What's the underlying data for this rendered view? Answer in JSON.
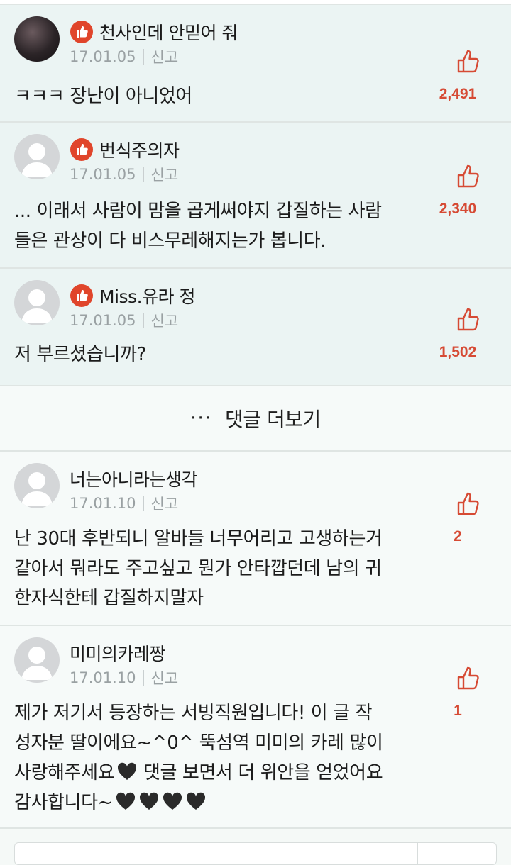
{
  "comments": [
    {
      "type": "best",
      "avatar": "photo",
      "nickname": "천사인데 안믿어 줘",
      "date": "17.01.05",
      "report": "신고",
      "lines": [
        "ㅋㅋㅋ 장난이 아니었어"
      ],
      "likes": "2,491"
    },
    {
      "type": "best",
      "avatar": "default",
      "nickname": "번식주의자",
      "date": "17.01.05",
      "report": "신고",
      "lines": [
        "... 이래서 사람이 맘을 곱게써야지 갑질하는 사람",
        "들은 관상이 다 비스무레해지는가 봅니다."
      ],
      "likes": "2,340"
    },
    {
      "type": "best",
      "avatar": "default",
      "nickname": "Miss.유라 정",
      "date": "17.01.05",
      "report": "신고",
      "lines": [
        "저 부르셨습니까?"
      ],
      "likes": "1,502"
    }
  ],
  "more_comments": {
    "dots": "···",
    "label": "댓글 더보기"
  },
  "recent_comments": [
    {
      "avatar": "default",
      "nickname": "너는아니라는생각",
      "date": "17.01.10",
      "report": "신고",
      "lines": [
        "난 30대 후반되니 알바들 너무어리고 고생하는거",
        "같아서 뭐라도 주고싶고 뭔가 안타깝던데 남의 귀",
        "한자식한테 갑질하지말자"
      ],
      "likes": "2"
    },
    {
      "avatar": "default",
      "nickname": "미미의카레짱",
      "date": "17.01.10",
      "report": "신고",
      "lines": [
        "제가 저기서 등장하는 서빙직원입니다! 이 글 작",
        "성자분 딸이에요~^0^ 뚝섬역 미미의 카레 많이",
        "사랑해주세요",
        "감사합니다~"
      ],
      "line3_tail": " 댓글 보면서 더 위안을 얻었어요",
      "likes": "1"
    }
  ],
  "icons": {
    "best_badge": "best-thumb-badge-icon",
    "like": "thumbs-up-outline-icon",
    "heart": "black-heart-icon"
  },
  "colors": {
    "accent": "#d64a34",
    "best_bg": "#ebf4f3",
    "normal_bg": "#f6faf9"
  }
}
